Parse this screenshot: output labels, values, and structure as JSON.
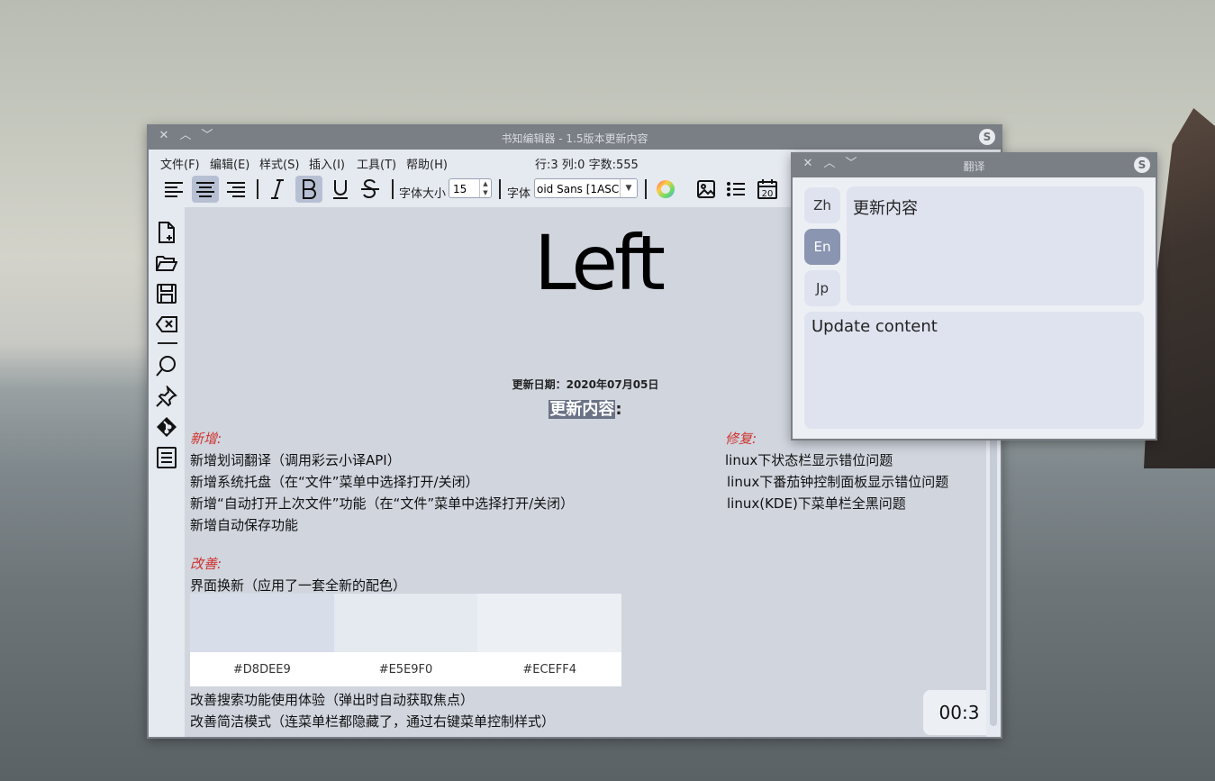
{
  "main_window": {
    "title": "书知编辑器 - 1.5版本更新内容",
    "menu": [
      "文件(F)",
      "编辑(E)",
      "样式(S)",
      "插入(I)",
      "工具(T)",
      "帮助(H)"
    ],
    "status": "行:3  列:0  字数:555",
    "toolbar": {
      "font_size_label": "字体大小",
      "font_size_value": "15",
      "font_label": "字体",
      "font_value": "oid Sans [1ASC]",
      "calendar_day": "20"
    },
    "doc": {
      "big_text": "Left",
      "date": "更新日期：2020年07月05日",
      "title_selected": "更新内容",
      "title_rest": ":",
      "new_heading": "新增:",
      "new_items": [
        "新增划词翻译（调用彩云小译API）",
        "新增系统托盘（在“文件”菜单中选择打开/关闭）",
        "新增“自动打开上次文件”功能（在“文件”菜单中选择打开/关闭）",
        "新增自动保存功能"
      ],
      "fix_heading": "修复:",
      "fix_items": [
        "linux下状态栏显示错位问题",
        "linux下番茄钟控制面板显示错位问题",
        "linux(KDE)下菜单栏全黑问题"
      ],
      "improve_heading": "改善:",
      "improve_items": [
        "界面换新（应用了一套全新的配色）",
        "改善搜索功能使用体验（弹出时自动获取焦点）",
        "改善简洁模式（连菜单栏都隐藏了，通过右键菜单控制样式）"
      ],
      "swatches": [
        {
          "label": "#D8DEE9",
          "color": "#D8DEE9"
        },
        {
          "label": "#E5E9F0",
          "color": "#E5E9F0"
        },
        {
          "label": "#ECEFF4",
          "color": "#ECEFF4"
        }
      ],
      "timer": "00:3"
    }
  },
  "translate_window": {
    "title": "翻译",
    "langs": [
      "Zh",
      "En",
      "Jp"
    ],
    "active_lang": "En",
    "source_text": "更新内容",
    "result_text": "Update content"
  }
}
